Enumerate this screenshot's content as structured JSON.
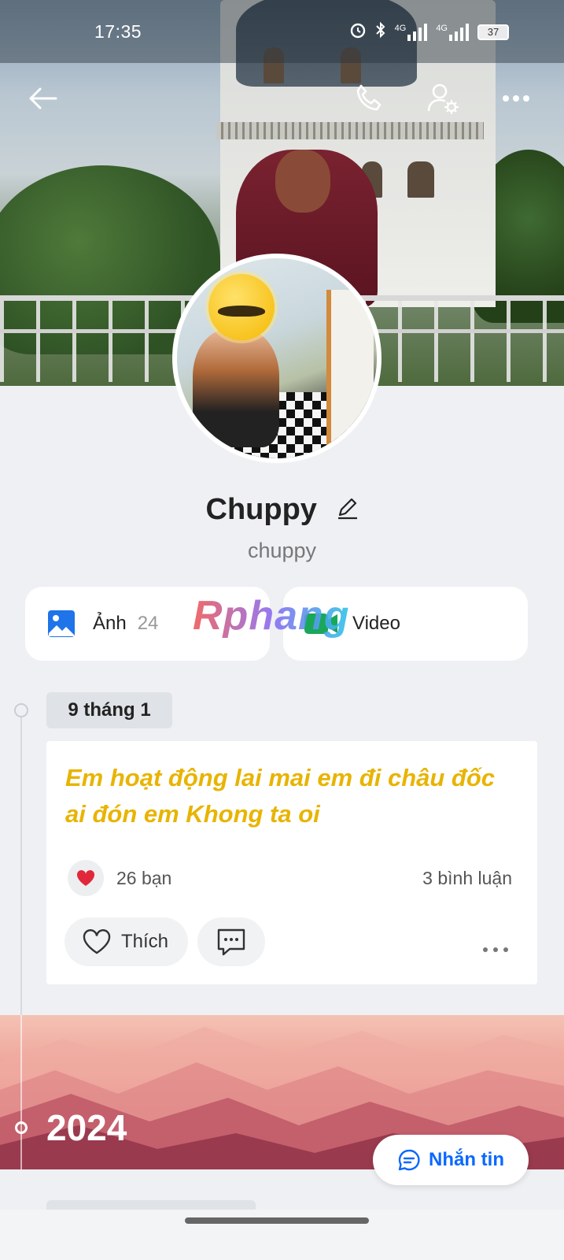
{
  "status_bar": {
    "time": "17:35",
    "network_1": "4G",
    "network_2": "4G",
    "battery": "37"
  },
  "header": {
    "back_icon": "arrow-left-icon",
    "call_icon": "phone-icon",
    "settings_icon": "user-settings-icon",
    "more_icon": "more-horizontal-icon"
  },
  "profile": {
    "name": "Chuppy",
    "handle": "chuppy"
  },
  "media_tiles": {
    "photos_label": "Ảnh",
    "photos_count": "24",
    "video_label": "Video"
  },
  "watermark": "Rphang",
  "timeline": {
    "date_label": "9 tháng 1",
    "post": {
      "text": "Em hoạt động lai mai em đi châu đốc ai đón em Khong ta oi",
      "text_color": "#e8b400",
      "reactions": "26 bạn",
      "comments": "3 bình luận",
      "like_label": "Thích"
    },
    "year_label": "2024"
  },
  "message_button": {
    "label": "Nhắn tin",
    "color": "#0a68ff"
  }
}
